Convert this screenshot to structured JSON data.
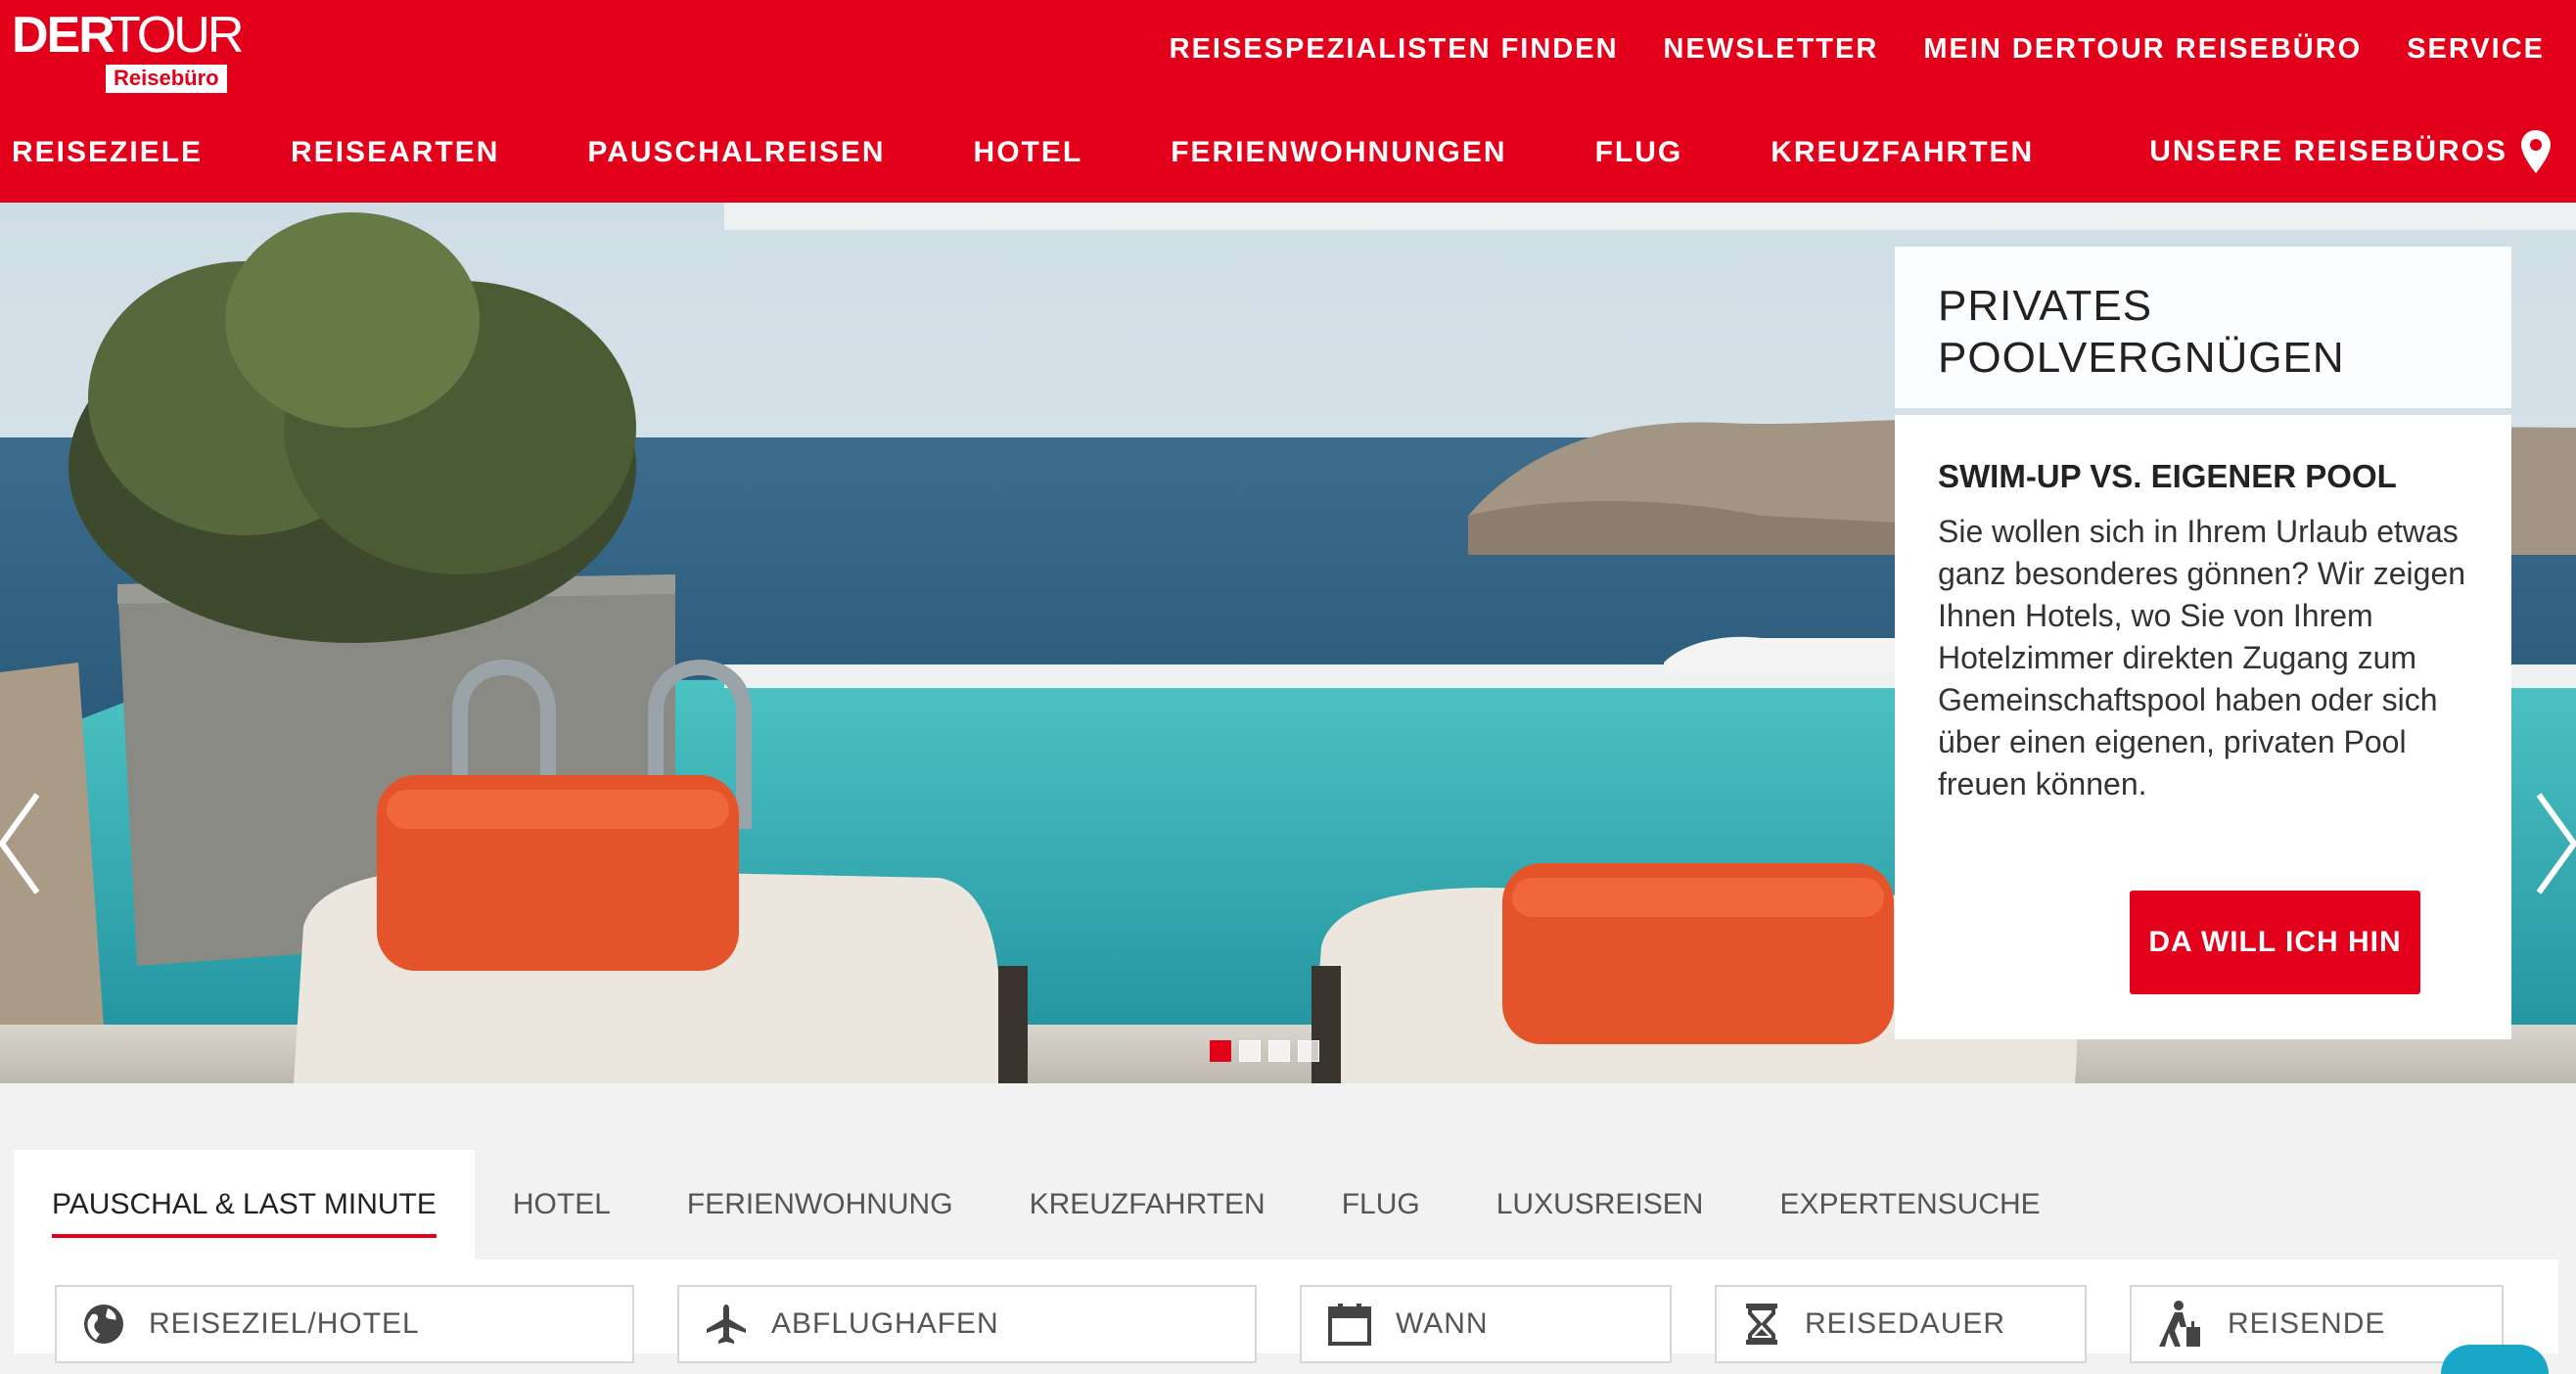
{
  "brand": {
    "primary_color": "#e2001a",
    "logo_der": "DER",
    "logo_tour": "TOUR",
    "logo_sub": "Reisebüro"
  },
  "top_nav": [
    "REISESPEZIALISTEN FINDEN",
    "NEWSLETTER",
    "MEIN DERTOUR REISEBÜRO",
    "SERVICE"
  ],
  "main_nav": [
    "REISEZIELE",
    "REISEARTEN",
    "PAUSCHALREISEN",
    "HOTEL",
    "FERIENWOHNUNGEN",
    "FLUG",
    "KREUZFAHRTEN"
  ],
  "stores_label": "UNSERE REISEBÜROS",
  "hero": {
    "card_title": "PRIVATES POOLVERGNÜGEN",
    "card_heading": "SWIM-UP VS. EIGENER POOL",
    "card_text": "Sie wollen sich in Ihrem Urlaub etwas ganz besonderes gönnen? Wir zeigen Ihnen Hotels, wo Sie von Ihrem Hotelzimmer direkten Zugang zum Gemeinschaftspool haben oder sich über einen eigenen, privaten Pool freuen können.",
    "cta_label": "DA WILL ICH HIN",
    "slides_total": 4,
    "active_slide": 1
  },
  "search": {
    "tabs": [
      "PAUSCHAL & LAST MINUTE",
      "HOTEL",
      "FERIENWOHNUNG",
      "KREUZFAHRTEN",
      "FLUG",
      "LUXUSREISEN",
      "EXPERTENSUCHE"
    ],
    "active_tab": 0,
    "fields": [
      {
        "label": "REISEZIEL/HOTEL",
        "icon": "globe-icon"
      },
      {
        "label": "ABFLUGHAFEN",
        "icon": "plane-icon"
      },
      {
        "label": "WANN",
        "icon": "calendar-icon"
      },
      {
        "label": "REISEDAUER",
        "icon": "hourglass-icon"
      },
      {
        "label": "REISENDE",
        "icon": "traveler-icon"
      }
    ]
  }
}
